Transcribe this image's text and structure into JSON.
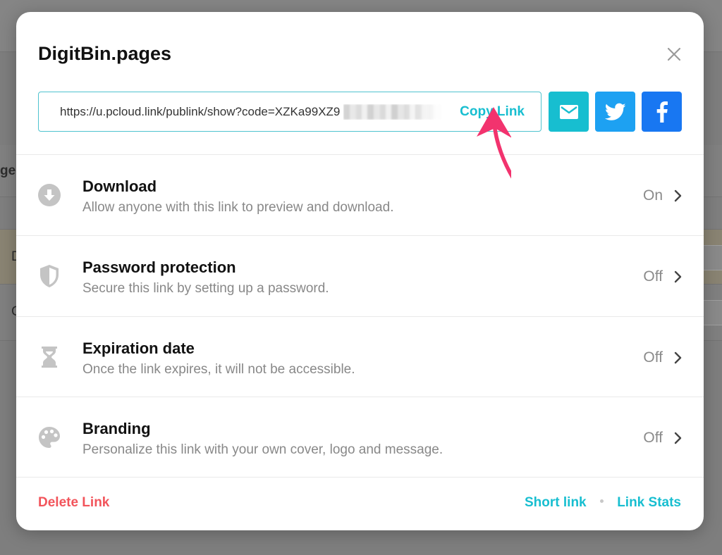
{
  "background": {
    "fragment_top": "ge",
    "fragment_mid1": "D",
    "fragment_mid2": "C"
  },
  "modal": {
    "title": "DigitBin.pages",
    "link_url": "https://u.pcloud.link/publink/show?code=XZKa99XZ9",
    "copy_label": "Copy Link",
    "share": {
      "mail_icon": "mail-icon",
      "twitter_icon": "twitter-icon",
      "facebook_icon": "facebook-icon"
    },
    "settings": [
      {
        "icon": "download-circle-icon",
        "title": "Download",
        "description": "Allow anyone with this link to preview and download.",
        "status": "On"
      },
      {
        "icon": "shield-icon",
        "title": "Password protection",
        "description": "Secure this link by setting up a password.",
        "status": "Off"
      },
      {
        "icon": "hourglass-icon",
        "title": "Expiration date",
        "description": "Once the link expires, it will not be accessible.",
        "status": "Off"
      },
      {
        "icon": "palette-icon",
        "title": "Branding",
        "description": "Personalize this link with your own cover, logo and message.",
        "status": "Off"
      }
    ],
    "footer": {
      "delete_label": "Delete Link",
      "short_link_label": "Short link",
      "stats_label": "Link Stats"
    }
  },
  "colors": {
    "accent": "#17bed0",
    "danger": "#f2545b",
    "twitter": "#1da1f2",
    "facebook": "#1877f2",
    "annotation_arrow": "#f2336e"
  }
}
